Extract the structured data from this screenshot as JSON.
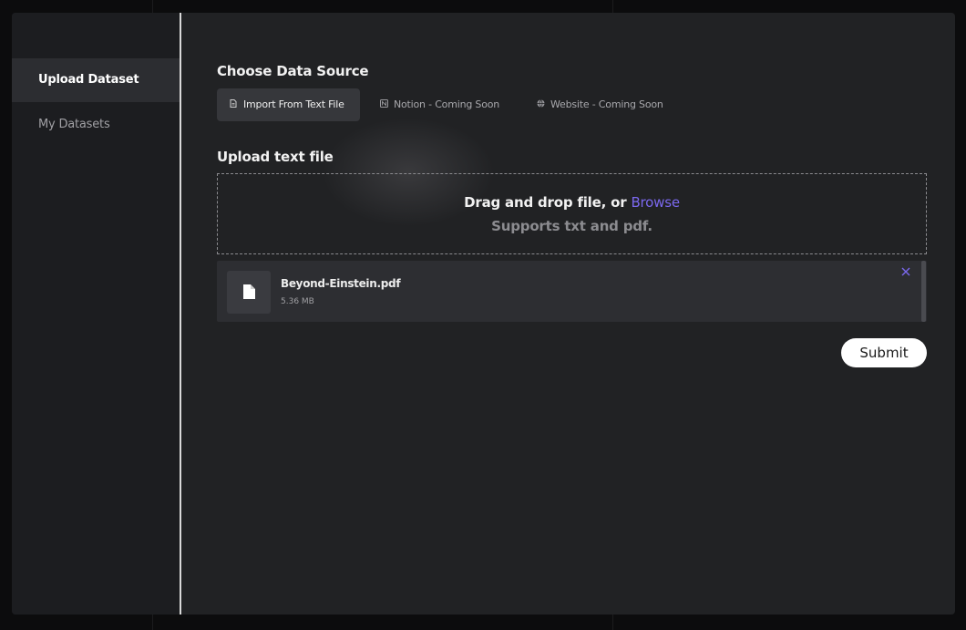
{
  "sidebar": {
    "items": [
      {
        "label": "Upload Dataset",
        "active": true
      },
      {
        "label": "My Datasets",
        "active": false
      }
    ]
  },
  "main": {
    "source_title": "Choose Data Source",
    "tabs": [
      {
        "label": "Import From Text File",
        "icon": "text-file-icon",
        "active": true
      },
      {
        "label": "Notion - Coming Soon",
        "icon": "notion-icon",
        "active": false
      },
      {
        "label": "Website - Coming Soon",
        "icon": "globe-icon",
        "active": false
      }
    ],
    "upload_title": "Upload text file",
    "dropzone": {
      "prompt": "Drag and drop file, or",
      "browse_label": "Browse",
      "supports": "Supports txt and pdf."
    },
    "file": {
      "name": "Beyond-Einstein.pdf",
      "size": "5.36 MB",
      "icon": "file-icon",
      "close_icon": "close-icon"
    },
    "submit_label": "Submit"
  },
  "colors": {
    "accent": "#7b68ee",
    "window_bg": "#212224",
    "sidebar_bg": "#1c1d20"
  }
}
